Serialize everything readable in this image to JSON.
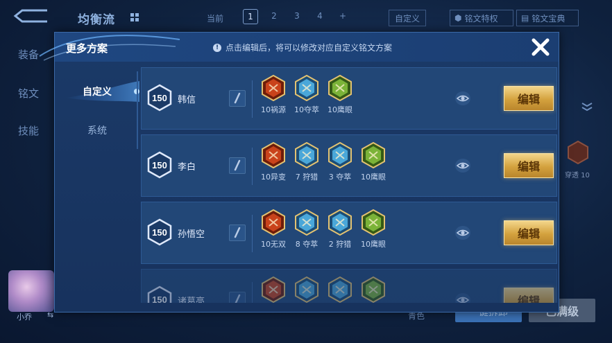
{
  "background": {
    "title": "均衡流",
    "current_label": "当前",
    "pages": [
      "1",
      "2",
      "3",
      "4",
      "+"
    ],
    "active_page": "1",
    "custom_label": "自定义",
    "privilege_label": "铭文特权",
    "treasure_label": "铭文宝典",
    "left_tabs": [
      "装备",
      "铭文",
      "技能"
    ],
    "hero_name": "小乔",
    "hero_swap_icon": "swap-icon",
    "side_rune_label": "穿透 10",
    "bottom_text": "青色",
    "one_click_label": "一键拆卸",
    "max_level_label": "已满级"
  },
  "modal": {
    "title": "更多方案",
    "hint": "点击编辑后，将可以修改对应自定义铭文方案",
    "hint_icon": "info-icon",
    "close_icon": "close-icon",
    "tabs": [
      {
        "label": "自定义",
        "active": true
      },
      {
        "label": "系统",
        "active": false
      }
    ],
    "rows": [
      {
        "level": "150",
        "hero": "韩信",
        "runes": [
          {
            "label": "10祸源",
            "color": "red"
          },
          {
            "label": "10夺萃",
            "color": "blue"
          },
          {
            "label": "10鹰眼",
            "color": "green"
          }
        ],
        "edit_label": "编辑"
      },
      {
        "level": "150",
        "hero": "李白",
        "runes": [
          {
            "label": "10异变",
            "color": "red"
          },
          {
            "label": "7 狩猎",
            "color": "blue"
          },
          {
            "label": "3 夺萃",
            "color": "blue"
          },
          {
            "label": "10鹰眼",
            "color": "green"
          }
        ],
        "edit_label": "编辑"
      },
      {
        "level": "150",
        "hero": "孙悟空",
        "runes": [
          {
            "label": "10无双",
            "color": "red"
          },
          {
            "label": "8 夺萃",
            "color": "blue"
          },
          {
            "label": "2 狩猎",
            "color": "blue"
          },
          {
            "label": "10鹰眼",
            "color": "green"
          }
        ],
        "edit_label": "编辑"
      },
      {
        "level": "150",
        "hero": "诸葛亮",
        "runes": [
          {
            "label": "",
            "color": "red"
          },
          {
            "label": "",
            "color": "blue"
          },
          {
            "label": "",
            "color": "blue"
          },
          {
            "label": "",
            "color": "green"
          }
        ],
        "edit_label": "编辑"
      }
    ]
  },
  "colors": {
    "rune_red": "#c9431b",
    "rune_blue": "#4aa7d9",
    "rune_green": "#7bb338",
    "edit_gold": "#d4a23e",
    "accent_blue": "#3b72b7"
  }
}
